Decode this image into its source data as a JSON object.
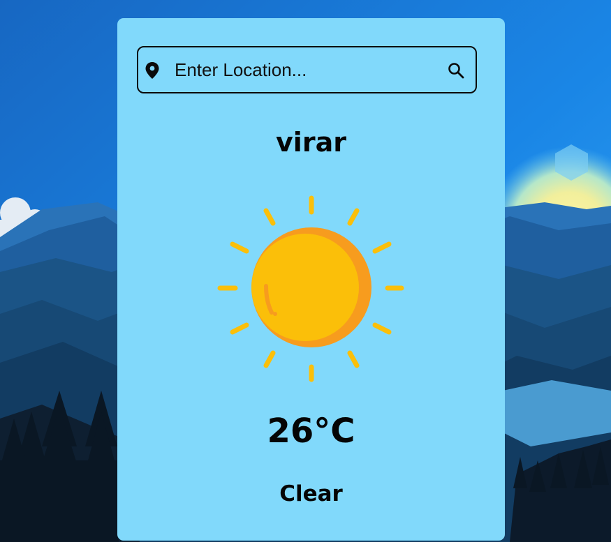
{
  "search": {
    "placeholder": "Enter Location...",
    "value": ""
  },
  "weather": {
    "city": "virar",
    "temperature": "26°C",
    "condition": "Clear",
    "icon": "sun-icon"
  },
  "colors": {
    "card_background": "#81d9fb",
    "sky_top": "#1a6fc8",
    "sun_yellow": "#fbbf09",
    "sun_shade": "#f79c1e",
    "text": "#050505"
  },
  "icons": {
    "location": "map-pin-icon",
    "search": "magnifier-icon"
  }
}
